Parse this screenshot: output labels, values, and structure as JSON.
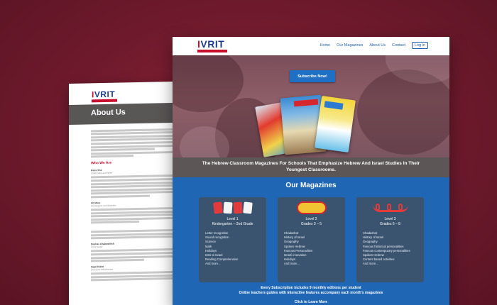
{
  "brand": {
    "logo_word": "IVRIT",
    "logo_i": "I",
    "logo_rest": "VRIT"
  },
  "about_page": {
    "band_title": "About Us",
    "who_we_are": "Who We Are",
    "people": [
      {
        "name": "Rami Shir",
        "role": "Chief Editor and Writer"
      },
      {
        "name": "Irit Moor",
        "role": "Art Designer and Illustrator"
      },
      {
        "name": "Deshas Chabashlick",
        "role": "Proof reader"
      },
      {
        "name": "Sigal Kabla",
        "role": "Executive Administrator"
      }
    ]
  },
  "home_page": {
    "nav": {
      "home": "Home",
      "magazines": "Our Magazines",
      "about": "About Us",
      "contact": "Contact",
      "login": "Log in"
    },
    "subscribe_button": "Subscribe Now!",
    "tagline_line1": "The Hebrew Classroom Magazines For Schools That Emphasize Hebrew And Israel Studies In Their",
    "tagline_line2": "Youngest Classrooms.",
    "magazines_heading": "Our Magazines",
    "levels": [
      {
        "level": "Level 1",
        "grades": "Kindergarten – 2nd Grade",
        "items": [
          "Letter recognition",
          "Sound recognition",
          "Science",
          "Math",
          "Holidays",
          "Intro to Israel",
          "Reading Comprehension",
          "And more..."
        ]
      },
      {
        "level": "Level 2",
        "grades": "Grades 3 – 5",
        "items": [
          "Chadashot",
          "History of Israel",
          "Geography",
          "Spoken Hebrew",
          "Famous Personalities",
          "Israeli innovation",
          "Holidays",
          "And more..."
        ]
      },
      {
        "level": "Level 3",
        "grades": "Grades 6 – 8",
        "items": [
          "Chadashot",
          "History of Israel",
          "Geography",
          "Famous historical personalities",
          "Famous contemporary personalities",
          "Spoken Hebrew",
          "Content based activities",
          "And more..."
        ]
      }
    ],
    "footer_line1": "Every Subscription includes 9 monthly editions per student",
    "footer_line2": "Online teachers guides with interactive features accompany each month's magazines",
    "footer_line3": "Click to Learn More"
  },
  "colors": {
    "background": "#6e1a2c",
    "brand_blue": "#1f5fae",
    "brand_red": "#c8102e",
    "section_blue": "#1f67b4",
    "card": "#3a5470",
    "band_gray": "#5d5656"
  },
  "icons": {
    "cover_1": "magazine-cover-red",
    "cover_2": "magazine-cover-blue",
    "cover_3": "magazine-cover-yellow"
  }
}
